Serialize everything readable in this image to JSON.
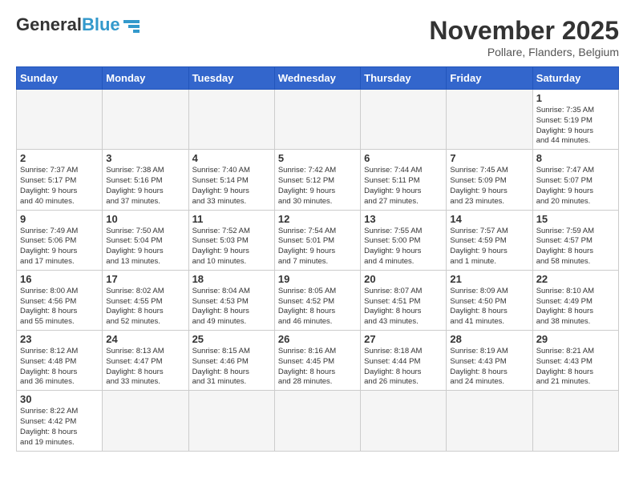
{
  "header": {
    "logo_text_general": "General",
    "logo_text_blue": "Blue",
    "month_title": "November 2025",
    "location": "Pollare, Flanders, Belgium"
  },
  "weekdays": [
    "Sunday",
    "Monday",
    "Tuesday",
    "Wednesday",
    "Thursday",
    "Friday",
    "Saturday"
  ],
  "weeks": [
    [
      {
        "day": "",
        "info": ""
      },
      {
        "day": "",
        "info": ""
      },
      {
        "day": "",
        "info": ""
      },
      {
        "day": "",
        "info": ""
      },
      {
        "day": "",
        "info": ""
      },
      {
        "day": "",
        "info": ""
      },
      {
        "day": "1",
        "info": "Sunrise: 7:35 AM\nSunset: 5:19 PM\nDaylight: 9 hours\nand 44 minutes."
      }
    ],
    [
      {
        "day": "2",
        "info": "Sunrise: 7:37 AM\nSunset: 5:17 PM\nDaylight: 9 hours\nand 40 minutes."
      },
      {
        "day": "3",
        "info": "Sunrise: 7:38 AM\nSunset: 5:16 PM\nDaylight: 9 hours\nand 37 minutes."
      },
      {
        "day": "4",
        "info": "Sunrise: 7:40 AM\nSunset: 5:14 PM\nDaylight: 9 hours\nand 33 minutes."
      },
      {
        "day": "5",
        "info": "Sunrise: 7:42 AM\nSunset: 5:12 PM\nDaylight: 9 hours\nand 30 minutes."
      },
      {
        "day": "6",
        "info": "Sunrise: 7:44 AM\nSunset: 5:11 PM\nDaylight: 9 hours\nand 27 minutes."
      },
      {
        "day": "7",
        "info": "Sunrise: 7:45 AM\nSunset: 5:09 PM\nDaylight: 9 hours\nand 23 minutes."
      },
      {
        "day": "8",
        "info": "Sunrise: 7:47 AM\nSunset: 5:07 PM\nDaylight: 9 hours\nand 20 minutes."
      }
    ],
    [
      {
        "day": "9",
        "info": "Sunrise: 7:49 AM\nSunset: 5:06 PM\nDaylight: 9 hours\nand 17 minutes."
      },
      {
        "day": "10",
        "info": "Sunrise: 7:50 AM\nSunset: 5:04 PM\nDaylight: 9 hours\nand 13 minutes."
      },
      {
        "day": "11",
        "info": "Sunrise: 7:52 AM\nSunset: 5:03 PM\nDaylight: 9 hours\nand 10 minutes."
      },
      {
        "day": "12",
        "info": "Sunrise: 7:54 AM\nSunset: 5:01 PM\nDaylight: 9 hours\nand 7 minutes."
      },
      {
        "day": "13",
        "info": "Sunrise: 7:55 AM\nSunset: 5:00 PM\nDaylight: 9 hours\nand 4 minutes."
      },
      {
        "day": "14",
        "info": "Sunrise: 7:57 AM\nSunset: 4:59 PM\nDaylight: 9 hours\nand 1 minute."
      },
      {
        "day": "15",
        "info": "Sunrise: 7:59 AM\nSunset: 4:57 PM\nDaylight: 8 hours\nand 58 minutes."
      }
    ],
    [
      {
        "day": "16",
        "info": "Sunrise: 8:00 AM\nSunset: 4:56 PM\nDaylight: 8 hours\nand 55 minutes."
      },
      {
        "day": "17",
        "info": "Sunrise: 8:02 AM\nSunset: 4:55 PM\nDaylight: 8 hours\nand 52 minutes."
      },
      {
        "day": "18",
        "info": "Sunrise: 8:04 AM\nSunset: 4:53 PM\nDaylight: 8 hours\nand 49 minutes."
      },
      {
        "day": "19",
        "info": "Sunrise: 8:05 AM\nSunset: 4:52 PM\nDaylight: 8 hours\nand 46 minutes."
      },
      {
        "day": "20",
        "info": "Sunrise: 8:07 AM\nSunset: 4:51 PM\nDaylight: 8 hours\nand 43 minutes."
      },
      {
        "day": "21",
        "info": "Sunrise: 8:09 AM\nSunset: 4:50 PM\nDaylight: 8 hours\nand 41 minutes."
      },
      {
        "day": "22",
        "info": "Sunrise: 8:10 AM\nSunset: 4:49 PM\nDaylight: 8 hours\nand 38 minutes."
      }
    ],
    [
      {
        "day": "23",
        "info": "Sunrise: 8:12 AM\nSunset: 4:48 PM\nDaylight: 8 hours\nand 36 minutes."
      },
      {
        "day": "24",
        "info": "Sunrise: 8:13 AM\nSunset: 4:47 PM\nDaylight: 8 hours\nand 33 minutes."
      },
      {
        "day": "25",
        "info": "Sunrise: 8:15 AM\nSunset: 4:46 PM\nDaylight: 8 hours\nand 31 minutes."
      },
      {
        "day": "26",
        "info": "Sunrise: 8:16 AM\nSunset: 4:45 PM\nDaylight: 8 hours\nand 28 minutes."
      },
      {
        "day": "27",
        "info": "Sunrise: 8:18 AM\nSunset: 4:44 PM\nDaylight: 8 hours\nand 26 minutes."
      },
      {
        "day": "28",
        "info": "Sunrise: 8:19 AM\nSunset: 4:43 PM\nDaylight: 8 hours\nand 24 minutes."
      },
      {
        "day": "29",
        "info": "Sunrise: 8:21 AM\nSunset: 4:43 PM\nDaylight: 8 hours\nand 21 minutes."
      }
    ],
    [
      {
        "day": "30",
        "info": "Sunrise: 8:22 AM\nSunset: 4:42 PM\nDaylight: 8 hours\nand 19 minutes."
      },
      {
        "day": "",
        "info": ""
      },
      {
        "day": "",
        "info": ""
      },
      {
        "day": "",
        "info": ""
      },
      {
        "day": "",
        "info": ""
      },
      {
        "day": "",
        "info": ""
      },
      {
        "day": "",
        "info": ""
      }
    ]
  ]
}
